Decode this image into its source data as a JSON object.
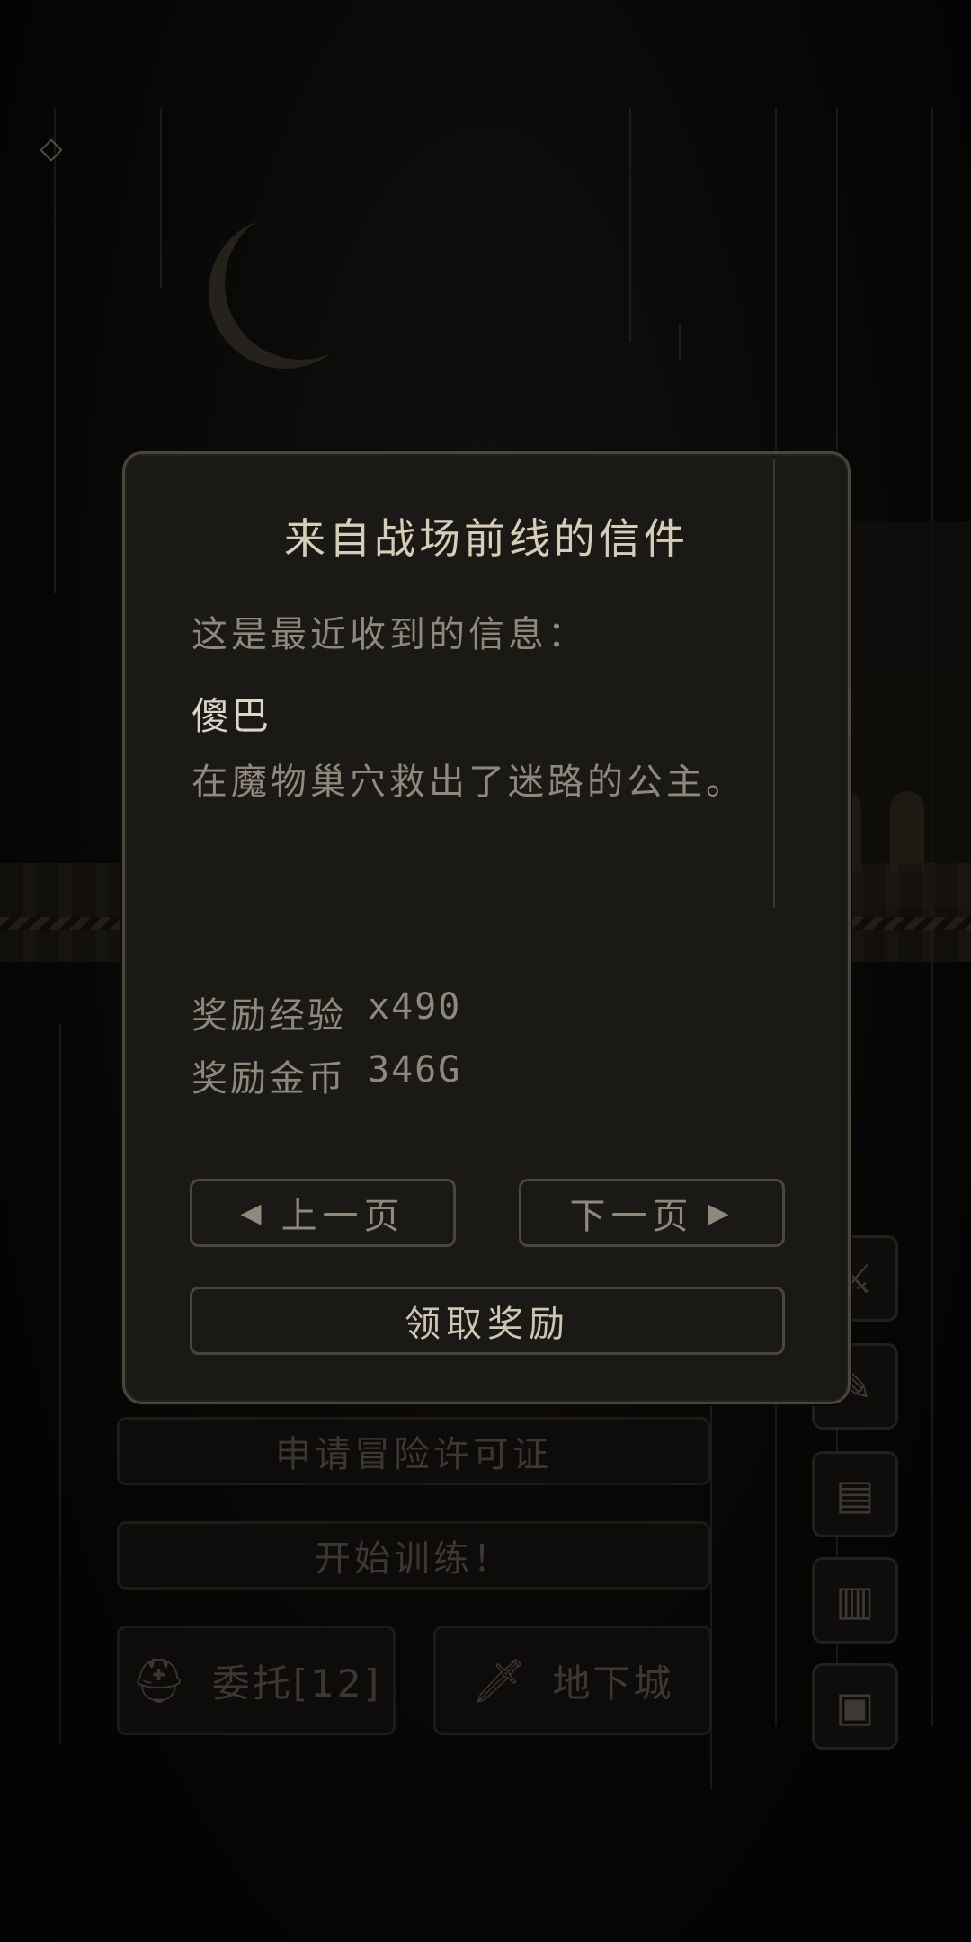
{
  "background": {
    "buttons": {
      "apply_license": "申请冒险许可证",
      "start_training": "开始训练！",
      "commission": "委托[12]",
      "dungeon": "地下城"
    },
    "icons": {
      "commission_icon": "knight-helmet-icon",
      "dungeon_icon": "sword-icon",
      "side_icons": [
        "sword-icon",
        "quill-icon",
        "map-icon",
        "book-icon",
        "computer-icon"
      ]
    }
  },
  "dialog": {
    "title": "来自战场前线的信件",
    "subtitle": "这是最近收到的信息：",
    "sender": "傻巴",
    "message": "在魔物巢穴救出了迷路的公主。",
    "rewards": [
      {
        "label": "奖励经验",
        "value": "x490"
      },
      {
        "label": "奖励金币",
        "value": "346G"
      }
    ],
    "prev_label": "上一页",
    "next_label": "下一页",
    "claim_label": "领取奖励"
  },
  "colors": {
    "dialog_bg": "#1b1916",
    "dialog_border": "#4b463d",
    "title_text": "#d6cdb6",
    "body_text": "#8f887b"
  }
}
